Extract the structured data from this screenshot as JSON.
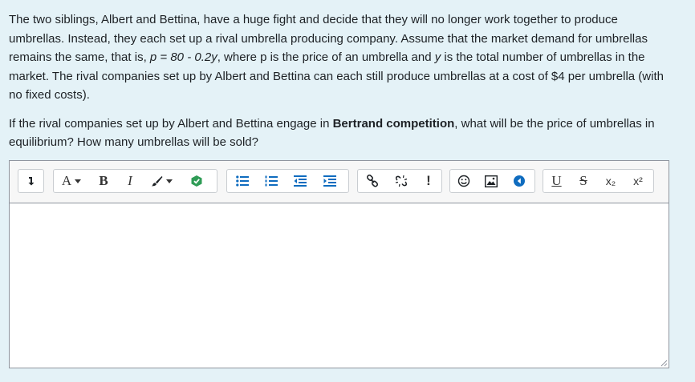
{
  "question": {
    "p1_a": "The two siblings, Albert and Bettina, have a huge fight and decide that they will no longer work together to produce umbrellas. Instead, they each set up a rival umbrella producing company. Assume that the market demand for umbrellas remains the same, that is, ",
    "p1_eq": "p = 80 - 0.2y",
    "p1_b": ", where p is the price of an umbrella and ",
    "p1_y": "y",
    "p1_c": " is the total number of umbrellas in the market. The rival companies set up by Albert and Bettina can each still produce umbrellas at a cost of $4 per umbrella (with no fixed costs).",
    "p2_a": "If the rival companies set up by Albert and Bettina engage in ",
    "p2_bold": "Bertrand competition",
    "p2_b": ", what will be the price of umbrellas in equilibrium? How many umbrellas will be sold?"
  },
  "toolbar": {
    "font_label": "A",
    "bold_label": "B",
    "italic_label": "I",
    "exclaim_label": "!",
    "underline_label": "U",
    "strike_label": "S",
    "sub_label": "x₂",
    "sup_label": "x²"
  },
  "colors": {
    "background": "#e4f2f7",
    "editor_border": "#8f959e",
    "accent_blue": "#0f6cbf",
    "accent_green": "#2f9c56"
  },
  "editor": {
    "value": ""
  }
}
